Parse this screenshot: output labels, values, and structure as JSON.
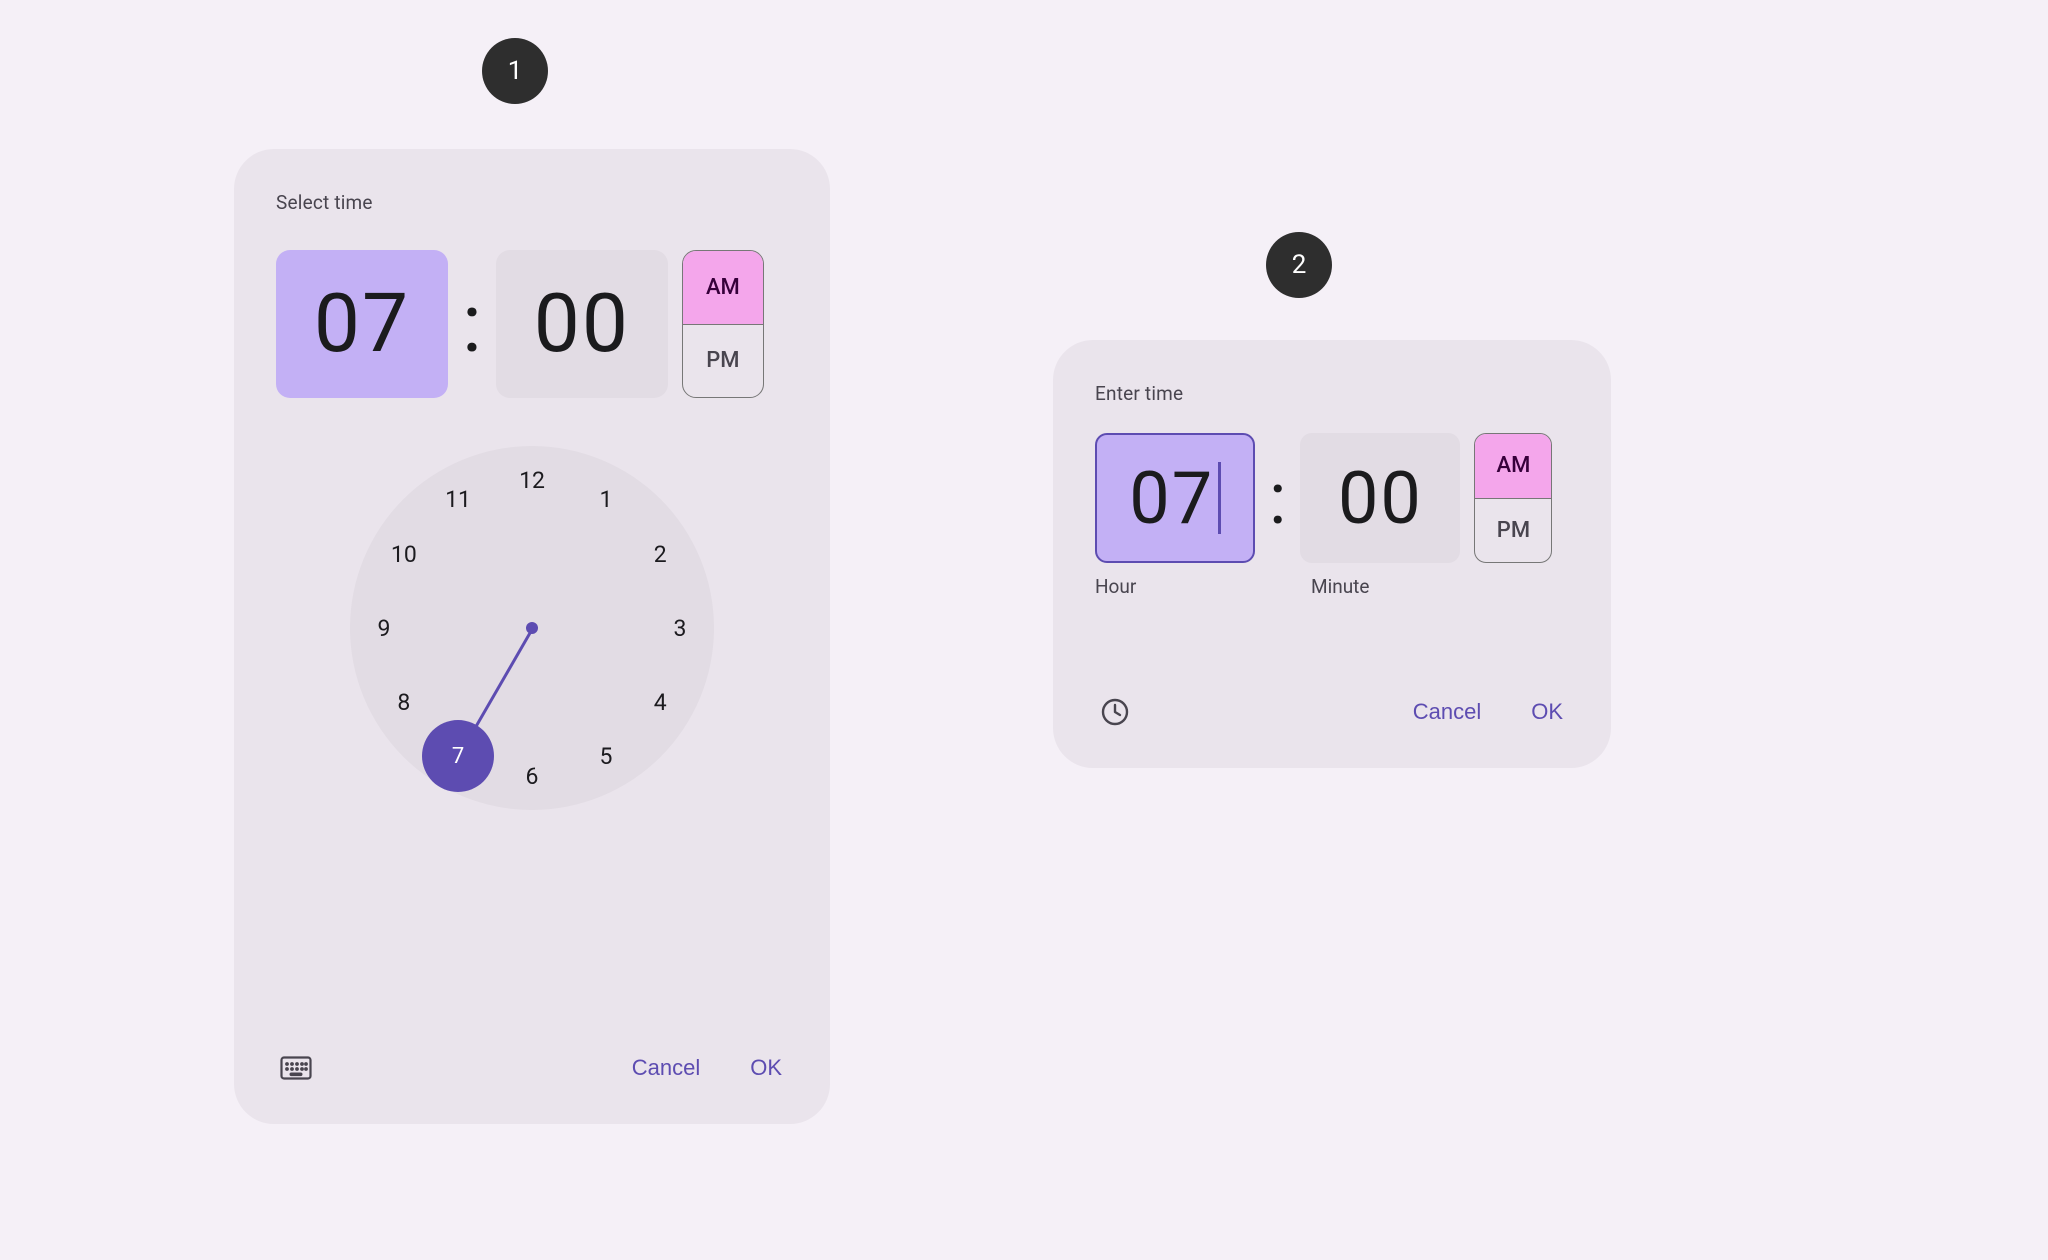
{
  "badges": {
    "one": "1",
    "two": "2"
  },
  "dialog1": {
    "title": "Select time",
    "hour": "07",
    "minute": "00",
    "am_label": "AM",
    "pm_label": "PM",
    "selected_period": "AM",
    "clock": {
      "values": [
        "12",
        "1",
        "2",
        "3",
        "4",
        "5",
        "6",
        "7",
        "8",
        "9",
        "10",
        "11"
      ],
      "selected_value": "7",
      "selected_index": 7
    },
    "cancel_label": "Cancel",
    "ok_label": "OK"
  },
  "dialog2": {
    "title": "Enter time",
    "hour": "07",
    "minute": "00",
    "am_label": "AM",
    "pm_label": "PM",
    "selected_period": "AM",
    "hour_label": "Hour",
    "minute_label": "Minute",
    "cancel_label": "Cancel",
    "ok_label": "OK"
  }
}
